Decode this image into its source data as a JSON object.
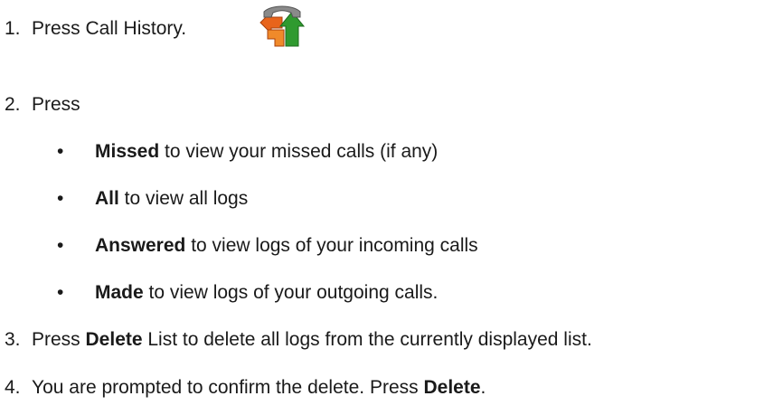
{
  "steps": [
    {
      "number": "1.",
      "text": "Press Call History."
    },
    {
      "number": "2.",
      "text": "Press",
      "bullets": [
        {
          "bold": "Missed",
          "rest": " to view your missed calls (if any)"
        },
        {
          "bold": "All",
          "rest": " to view all logs"
        },
        {
          "bold": "Answered",
          "rest": " to view logs of your incoming calls"
        },
        {
          "bold": "Made",
          "rest": " to view logs of your outgoing calls."
        }
      ]
    },
    {
      "number": "3.",
      "pre": "Press ",
      "bold": "Delete",
      "rest": " List to delete all logs from the currently displayed list."
    },
    {
      "number": "4.",
      "pre": "You are prompted to confirm the delete. Press ",
      "bold": "Delete",
      "rest": "."
    }
  ],
  "bullet_char": "•",
  "icon": "call-history-icon",
  "colors": {
    "text": "#1a1a1a",
    "icon_orange": "#e8641c",
    "icon_green": "#2f9a2f",
    "icon_gray": "#8a8a8a"
  }
}
